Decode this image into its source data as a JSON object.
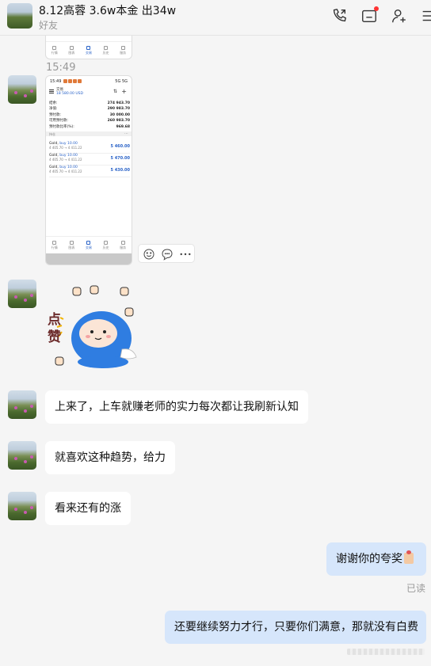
{
  "header": {
    "title": "8.12高蓉 3.6w本金 出34w",
    "subtitle": "好友"
  },
  "chat": {
    "time_label": "15:49",
    "screenshot_tabs": [
      "行情",
      "图表",
      "交易",
      "历史",
      "服务"
    ],
    "screenshot2": {
      "status_time": "15:49",
      "signal": "5G 5G",
      "account_name": "交易",
      "account_balance": "18 580.00 USD",
      "rows": [
        {
          "label": "结余:",
          "value": "274 943.70"
        },
        {
          "label": "净值:",
          "value": "290 983.70"
        },
        {
          "label": "预付款:",
          "value": "30 000.00"
        },
        {
          "label": "可用预付款:",
          "value": "260 983.70"
        },
        {
          "label": "预付款比率(%):",
          "value": "969.68"
        }
      ],
      "section_label": "持仓",
      "positions": [
        {
          "name": "Gold,",
          "dir": "buy 10.00",
          "detail": "4 405.70 → 4 411.22",
          "profit": "5 460.00"
        },
        {
          "name": "Gold,",
          "dir": "buy 10.00",
          "detail": "4 405.70 → 4 411.22",
          "profit": "5 470.00"
        },
        {
          "name": "Gold,",
          "dir": "buy 10.00",
          "detail": "4 405.70 → 4 411.22",
          "profit": "5 430.00"
        }
      ]
    },
    "sticker_text": "点赞",
    "messages": [
      {
        "text": "上来了，上车就赚老师的实力每次都让我刷新认知"
      },
      {
        "text": "就喜欢这种趋势，给力"
      },
      {
        "text": "看来还有的涨"
      },
      {
        "text": "谢谢你的夸奖"
      },
      {
        "text": "还要继续努力才行，只要你们满意，那就没有白费"
      }
    ],
    "read_label": "已读"
  },
  "icons": {
    "call": "phone-icon",
    "files": "folder-icon",
    "add_member": "add-user-icon",
    "more": "menu-icon",
    "emoji": "emoji-icon",
    "comment": "comment-icon",
    "more_actions": "more-icon"
  },
  "colors": {
    "accent": "#2a63c8",
    "my_bubble": "#d6e6fb",
    "badge": "#ff3333"
  }
}
